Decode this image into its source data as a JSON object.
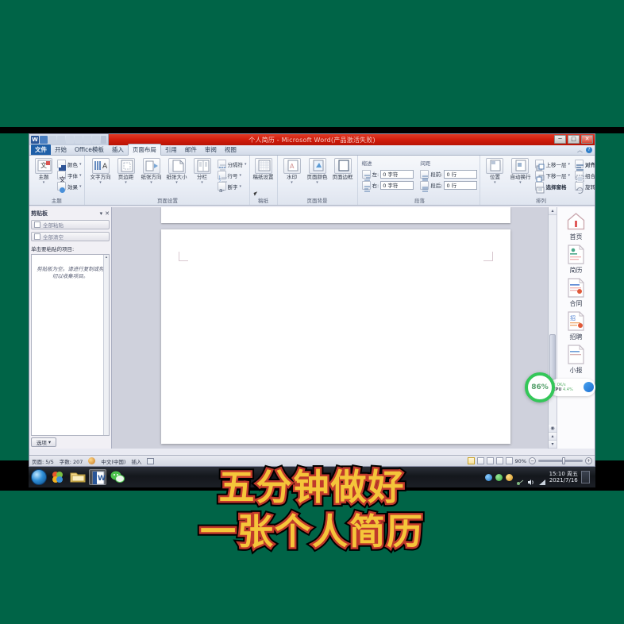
{
  "window": {
    "title": "个人简历 - Microsoft Word(产品激活失败)",
    "minimize": "─",
    "maximize": "□",
    "close": "✕"
  },
  "quick_access": {
    "items": [
      "word-icon",
      "save-icon",
      "undo-icon",
      "redo-icon",
      "quick-print-icon",
      "new-icon",
      "open-icon",
      "preview-icon",
      "customize-icon"
    ]
  },
  "tabs": [
    {
      "label": "文件",
      "type": "file"
    },
    {
      "label": "开始",
      "type": "normal"
    },
    {
      "label": "Office模板",
      "type": "normal"
    },
    {
      "label": "插入",
      "type": "normal"
    },
    {
      "label": "页面布局",
      "type": "active"
    },
    {
      "label": "引用",
      "type": "normal"
    },
    {
      "label": "邮件",
      "type": "normal"
    },
    {
      "label": "审阅",
      "type": "normal"
    },
    {
      "label": "视图",
      "type": "normal"
    }
  ],
  "help": {
    "collapse": "︿",
    "question": "?"
  },
  "ribbon": {
    "groups": [
      {
        "title": "主题",
        "big": [
          {
            "label": "主题",
            "caret": "▾",
            "icon": "themes-icon"
          }
        ],
        "small": [
          {
            "label": "颜色",
            "caret": "▾",
            "icon": "theme-colors-icon"
          },
          {
            "label": "字体",
            "caret": "▾",
            "icon": "theme-fonts-icon"
          },
          {
            "label": "效果",
            "caret": "▾",
            "icon": "theme-effects-icon"
          }
        ]
      },
      {
        "title": "页面设置",
        "dialog_launcher": "⊿",
        "big": [
          {
            "label": "文字方向",
            "caret": "▾",
            "icon": "text-direction-icon"
          },
          {
            "label": "页边距",
            "caret": "▾",
            "icon": "margins-icon"
          },
          {
            "label": "纸张方向",
            "caret": "▾",
            "icon": "orientation-icon"
          },
          {
            "label": "纸张大小",
            "caret": "▾",
            "icon": "paper-size-icon"
          },
          {
            "label": "分栏",
            "caret": "▾",
            "icon": "columns-icon"
          }
        ],
        "small": [
          {
            "label": "分隔符",
            "caret": "▾",
            "icon": "breaks-icon"
          },
          {
            "label": "行号",
            "caret": "▾",
            "icon": "line-numbers-icon"
          },
          {
            "label": "断字",
            "caret": "▾",
            "icon": "hyphenation-icon"
          }
        ]
      },
      {
        "title": "稿纸",
        "big": [
          {
            "label": "稿纸设置",
            "caret": "",
            "icon": "manuscript-settings-icon"
          }
        ],
        "small": []
      },
      {
        "title": "页面背景",
        "big": [
          {
            "label": "水印",
            "caret": "▾",
            "icon": "watermark-icon"
          },
          {
            "label": "页面颜色",
            "caret": "▾",
            "icon": "page-color-icon"
          },
          {
            "label": "页面边框",
            "caret": "",
            "icon": "page-borders-icon"
          }
        ],
        "small": []
      },
      {
        "title": "段落",
        "dialog_launcher": "⊿",
        "sub_left": "缩进",
        "sub_right": "间距",
        "fields": [
          {
            "label": "左:",
            "value": "0 字符",
            "icon": "indent-left-icon"
          },
          {
            "label": "右:",
            "value": "0 字符",
            "icon": "indent-right-icon"
          },
          {
            "label": "段前:",
            "value": "0 行",
            "icon": "space-before-icon"
          },
          {
            "label": "段后:",
            "value": "0 行",
            "icon": "space-after-icon"
          }
        ]
      },
      {
        "title": "排列",
        "big": [
          {
            "label": "位置",
            "caret": "▾",
            "icon": "position-icon"
          },
          {
            "label": "自动换行",
            "caret": "▾",
            "icon": "wrap-text-icon"
          }
        ],
        "small": [
          {
            "label": "上移一层",
            "caret": "▾",
            "icon": "bring-forward-icon"
          },
          {
            "label": "下移一层",
            "caret": "▾",
            "icon": "send-backward-icon"
          },
          {
            "label": "选择窗格",
            "caret": "",
            "icon": "selection-pane-icon"
          },
          {
            "label": "对齐",
            "caret": "▾",
            "icon": "align-icon"
          },
          {
            "label": "组合",
            "caret": "▾",
            "icon": "group-icon"
          },
          {
            "label": "旋转",
            "caret": "▾",
            "icon": "rotate-icon"
          }
        ]
      }
    ]
  },
  "clipboard": {
    "title": "剪贴板",
    "dropdown": "▾",
    "close": "✕",
    "paste_all": "全部粘贴",
    "clear_all": "全部清空",
    "hint": "单击要粘贴的项目:",
    "empty_message": "剪贴板为空。请进行复制或剪切以收集项目。",
    "options": "选项",
    "options_caret": "▾"
  },
  "sidebar": {
    "items": [
      {
        "label": "首页",
        "icon": "home-icon"
      },
      {
        "label": "简历",
        "icon": "resume-doc-icon"
      },
      {
        "label": "合同",
        "icon": "contract-doc-icon"
      },
      {
        "label": "招聘",
        "icon": "recruit-doc-icon"
      },
      {
        "label": "小报",
        "icon": "newsletter-doc-icon"
      }
    ]
  },
  "status_bar": {
    "page": "页面: 5/5",
    "words": "字数: 207",
    "proof_icon": "proofing-icon",
    "language": "中文(中国)",
    "insert_mode": "插入",
    "macro_icon": "record-macro-icon",
    "zoom": "90%",
    "zoom_out": "−",
    "zoom_in": "+",
    "views": [
      "print-layout-view",
      "full-screen-view",
      "web-layout-view",
      "outline-view",
      "draft-view"
    ]
  },
  "gauge": {
    "value": "86%",
    "net_speed": "0K/s",
    "cpu_label": "CPU",
    "cpu_value": "4.4%"
  },
  "taskbar": {
    "start": "start-orb",
    "apps": [
      "colorful-app-icon",
      "explorer-icon",
      "word-icon",
      "wechat-icon"
    ],
    "tray": [
      "tray-blue-icon",
      "tray-green-icon",
      "tray-orange-icon",
      "network-icon",
      "volume-icon",
      "signal-icon"
    ],
    "clock_time": "15:10 周五",
    "clock_date": "2021/7/16",
    "show_desktop": "show-desktop-button"
  },
  "caption": {
    "line1": "五分钟做好",
    "line2": "一张个人简历"
  },
  "colors": {
    "video_background": "#006447",
    "titlebar_red": "#d21d0c",
    "caption_gold": "#f5c53a",
    "caption_red_outline": "#c0392b",
    "gauge_green": "#34c759",
    "file_tab_blue": "#1e5fa8"
  }
}
